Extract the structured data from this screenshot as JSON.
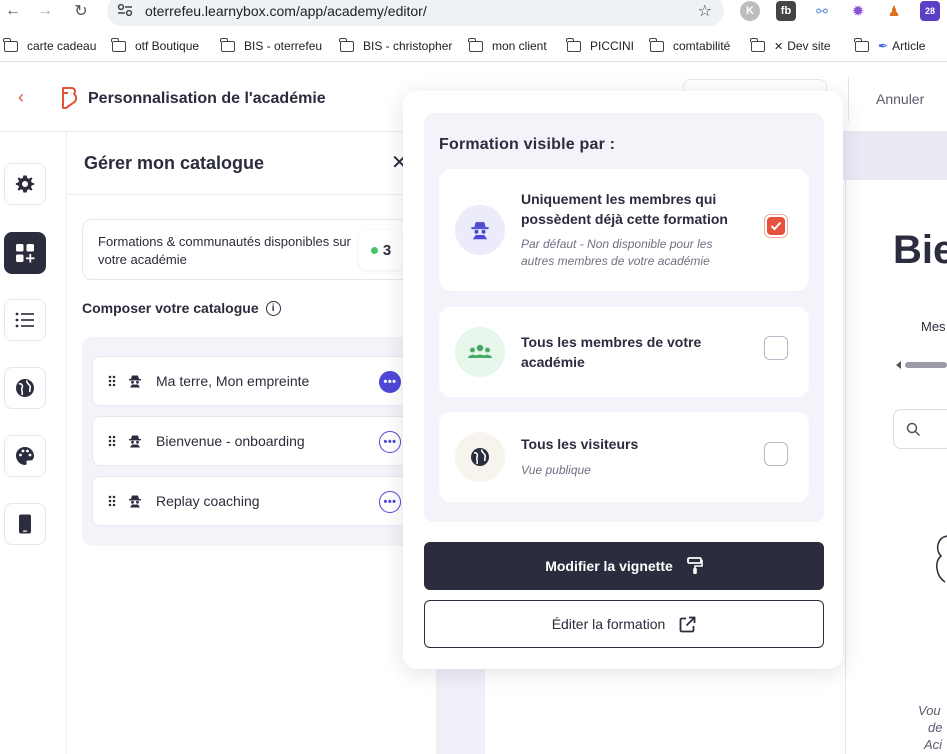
{
  "browser": {
    "url": "oterrefeu.learnybox.com/app/academy/editor/",
    "bookmarks": [
      "carte cadeau",
      "otf Boutique",
      "BIS - oterrefeu",
      "BIS - christopher",
      "mon client",
      "PICCINI",
      "comtabilité",
      "Dev site",
      "Article"
    ],
    "extension_badge": "28"
  },
  "header": {
    "title": "Personnalisation de l'académie",
    "cancel_label": "Annuler"
  },
  "sidebar": {
    "icons": [
      "gear-icon",
      "add-widget-icon",
      "list-icon",
      "globe-icon",
      "palette-icon",
      "tablet-icon"
    ]
  },
  "catalog": {
    "title": "Gérer mon catalogue",
    "close_label": "✕",
    "available_text": "Formations & communautés disponibles sur votre académie",
    "available_count": "3",
    "compose_title": "Composer votre catalogue",
    "items": [
      {
        "label": "Ma terre, Mon empreinte"
      },
      {
        "label": "Bienvenue - onboarding"
      },
      {
        "label": "Replay coaching"
      }
    ]
  },
  "visibility": {
    "title": "Formation visible par :",
    "options": [
      {
        "title": "Uniquement les membres qui possèdent déjà cette formation",
        "subtitle": "Par défaut - Non disponible pour les autres membres de votre académie",
        "checked": true
      },
      {
        "title": "Tous les membres de votre académie",
        "subtitle": "",
        "checked": false
      },
      {
        "title": "Tous les visiteurs",
        "subtitle": "Vue publique",
        "checked": false
      }
    ],
    "primary_button": "Modifier la vignette",
    "secondary_button": "Éditer la formation"
  },
  "preview": {
    "heading_partial": "Bie",
    "label_partial": "Mes",
    "footer_partial_1": "Vou",
    "footer_partial_2": "de",
    "footer_partial_3": "Aci"
  },
  "colors": {
    "accent": "#e5533d",
    "dark": "#2b2c3d",
    "primary_blue": "#4e48d6",
    "panel_bg": "#f3f3f9"
  }
}
